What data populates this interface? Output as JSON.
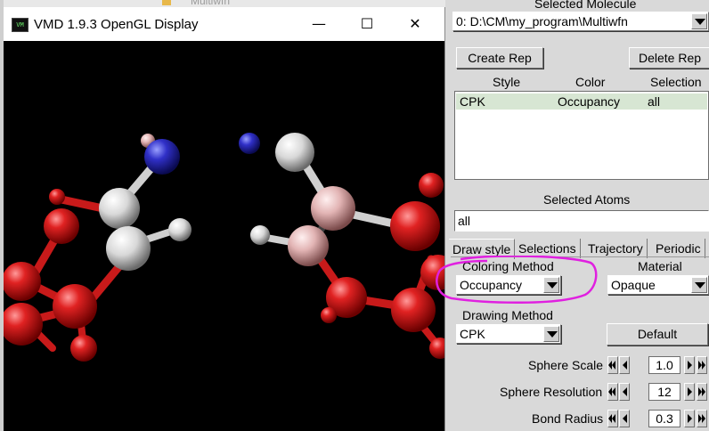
{
  "background": {
    "title": "Multiwfn"
  },
  "gl_window": {
    "title": "VMD 1.9.3 OpenGL Display",
    "icon_text": "VM",
    "minimize": "—",
    "maximize": "☐",
    "close": "✕"
  },
  "panel": {
    "selected_molecule_label": "Selected Molecule",
    "molecule_value": "0: D:\\CM\\my_program\\Multiwfn",
    "create_rep": "Create Rep",
    "delete_rep": "Delete Rep",
    "rep_headers": {
      "style": "Style",
      "color": "Color",
      "selection": "Selection"
    },
    "reps": [
      {
        "style": "CPK",
        "color": "Occupancy",
        "selection": "all"
      }
    ],
    "selected_atoms_label": "Selected Atoms",
    "selected_atoms_value": "all",
    "tabs": [
      "Draw style",
      "Selections",
      "Trajectory",
      "Periodic"
    ],
    "coloring_method_label": "Coloring Method",
    "coloring_method_value": "Occupancy",
    "material_label": "Material",
    "material_value": "Opaque",
    "drawing_method_label": "Drawing Method",
    "drawing_method_value": "CPK",
    "default_button": "Default",
    "sphere_scale_label": "Sphere Scale",
    "sphere_scale_value": "1.0",
    "sphere_resolution_label": "Sphere Resolution",
    "sphere_resolution_value": "12",
    "bond_radius_label": "Bond Radius",
    "bond_radius_value": "0.3"
  },
  "colors": {
    "oxygen_red": "#cc1414",
    "nitrogen_blue": "#2a2ab0",
    "carbon_white": "#dcdcdc",
    "pink": "#d9a3a3",
    "annotation_magenta": "#e020e0",
    "rep_row_bg": "#d7e6d3"
  }
}
